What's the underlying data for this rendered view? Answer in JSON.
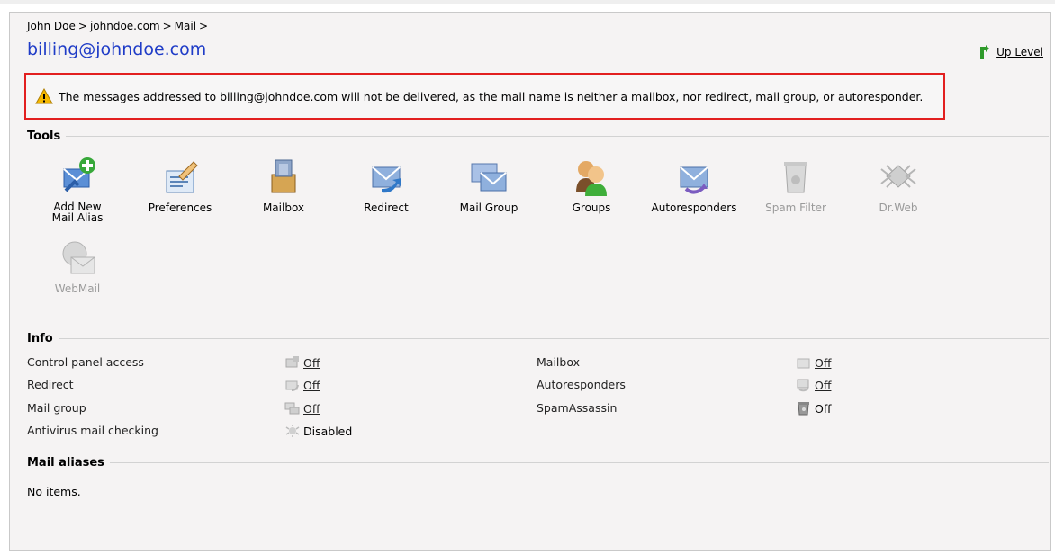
{
  "breadcrumb": [
    "John Doe",
    "johndoe.com",
    "Mail"
  ],
  "breadcrumb_sep": ">",
  "page_title": "billing@johndoe.com",
  "up_level": "Up Level",
  "warning": "The messages addressed to billing@johndoe.com will not be delivered, as the mail name is neither a mailbox, nor redirect, mail group, or autoresponder.",
  "sections": {
    "tools": "Tools",
    "info": "Info",
    "aliases": "Mail aliases"
  },
  "tools": [
    {
      "label": "Add New Mail Alias",
      "icon": "add-mail-alias-icon",
      "enabled": true
    },
    {
      "label": "Preferences",
      "icon": "preferences-icon",
      "enabled": true
    },
    {
      "label": "Mailbox",
      "icon": "mailbox-icon",
      "enabled": true
    },
    {
      "label": "Redirect",
      "icon": "redirect-icon",
      "enabled": true
    },
    {
      "label": "Mail Group",
      "icon": "mail-group-icon",
      "enabled": true
    },
    {
      "label": "Groups",
      "icon": "groups-icon",
      "enabled": true
    },
    {
      "label": "Autoresponders",
      "icon": "autoresponders-icon",
      "enabled": true
    },
    {
      "label": "Spam Filter",
      "icon": "spam-filter-icon",
      "enabled": false
    },
    {
      "label": "Dr.Web",
      "icon": "drweb-icon",
      "enabled": false
    },
    {
      "label": "WebMail",
      "icon": "webmail-icon",
      "enabled": false
    }
  ],
  "info": {
    "left": [
      {
        "label": "Control panel access",
        "value": "Off",
        "link": true
      },
      {
        "label": "Redirect",
        "value": "Off",
        "link": true
      },
      {
        "label": "Mail group",
        "value": "Off",
        "link": true
      },
      {
        "label": "Antivirus mail checking",
        "value": "Disabled",
        "link": false
      }
    ],
    "right": [
      {
        "label": "Mailbox",
        "value": "Off",
        "link": true
      },
      {
        "label": "Autoresponders",
        "value": "Off",
        "link": true
      },
      {
        "label": "SpamAssassin",
        "value": "Off",
        "link": false
      }
    ]
  },
  "aliases_empty": "No items.",
  "colors": {
    "title": "#1f3cc7",
    "warning_border": "#e21f1f",
    "panel_bg": "#f5f3f3",
    "up_arrow": "#2e9a2a"
  }
}
